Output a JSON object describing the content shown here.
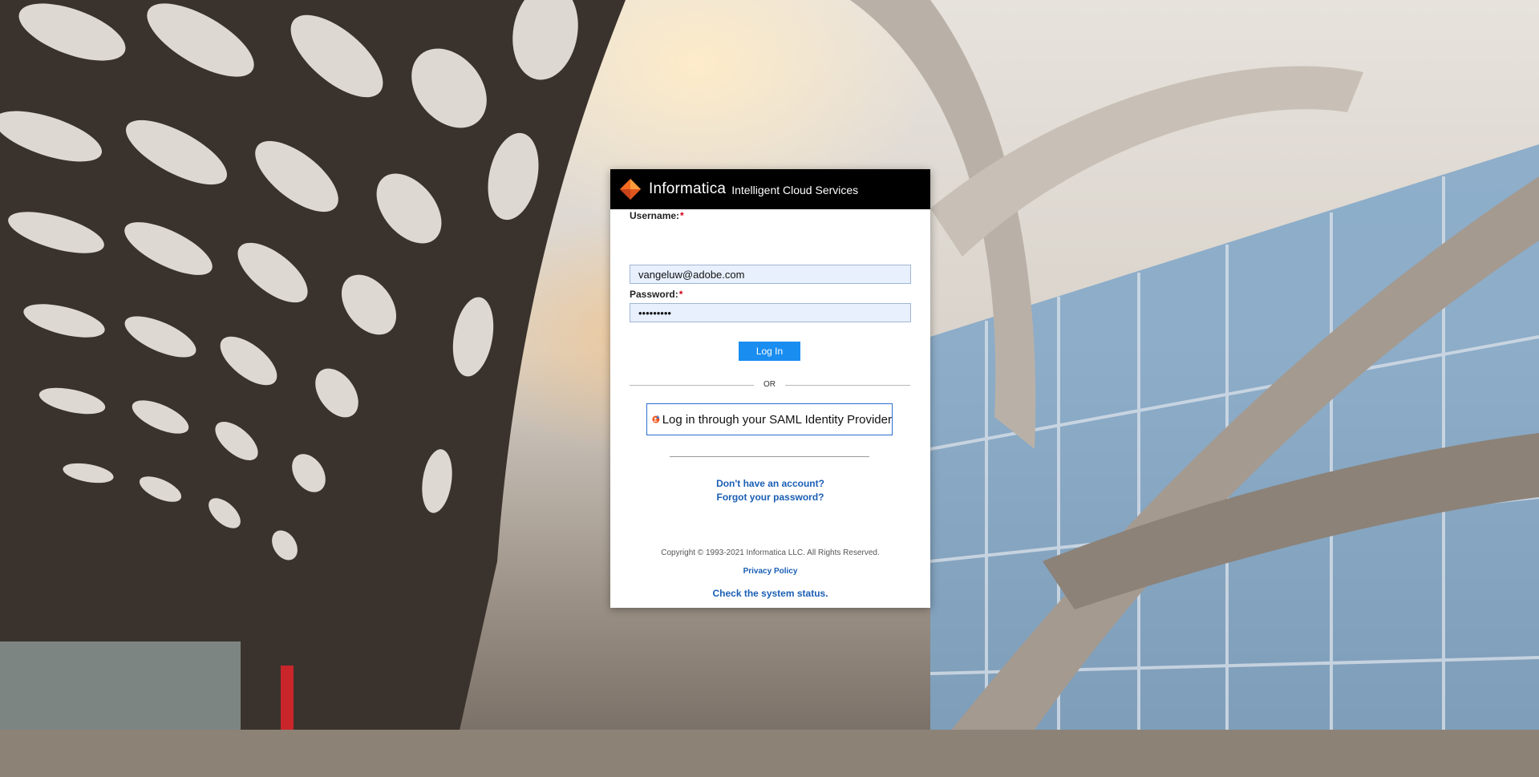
{
  "header": {
    "brand_name": "Informatica",
    "product_name": "Intelligent Cloud Services",
    "logo_icon": "informatica-diamond-logo"
  },
  "form": {
    "username_label": "Username:",
    "username_value": "vangeluw@adobe.com",
    "password_label": "Password:",
    "password_value": "•••••••••",
    "required_marker": "*",
    "login_label": "Log In"
  },
  "or_label": "OR",
  "saml": {
    "label": "Log in through your SAML Identity Provider",
    "icon": "saml-user-lock-icon"
  },
  "links": {
    "signup": "Don't have an account?",
    "forgot": "Forgot your password?",
    "privacy": "Privacy Policy",
    "status": "Check the system status."
  },
  "footer": {
    "copyright": "Copyright © 1993-2021 Informatica LLC. All Rights Reserved."
  },
  "colors": {
    "header_bg": "#000000",
    "accent_blue": "#1a8df0",
    "link_blue": "#1a5fb4",
    "required_red": "#d0021b",
    "brand_orange": "#f26b21"
  }
}
